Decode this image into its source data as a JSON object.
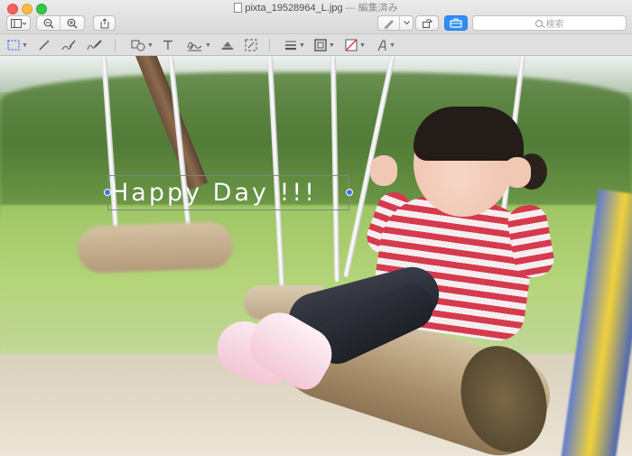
{
  "window": {
    "filename": "pixta_19528964_L.jpg",
    "separator": "—",
    "edited_label": "編集済み"
  },
  "toolbar": {
    "search_placeholder": "検索"
  },
  "annotation": {
    "text": "Happy Day !!!"
  },
  "icons": {
    "sidebar": "sidebar-icon",
    "zoom_out": "zoom-out-icon",
    "zoom_in": "zoom-in-icon",
    "share": "share-icon",
    "pen": "pen-icon",
    "rotate": "rotate-icon",
    "toolbox": "toolbox-icon",
    "select": "rect-selection-icon",
    "instant_alpha": "magic-wand-icon",
    "sketch": "sketch-icon",
    "draw": "draw-icon",
    "shapes": "shapes-icon",
    "text": "text-icon",
    "sign": "signature-icon",
    "adjust_color": "adjust-color-icon",
    "adjust_size": "adjust-size-icon",
    "shape_style": "line-style-icon",
    "border_color": "border-color-icon",
    "fill_color": "fill-color-icon",
    "text_style": "text-style-icon"
  },
  "colors": {
    "accent": "#2f8ef6",
    "handle": "#3a7be0"
  }
}
